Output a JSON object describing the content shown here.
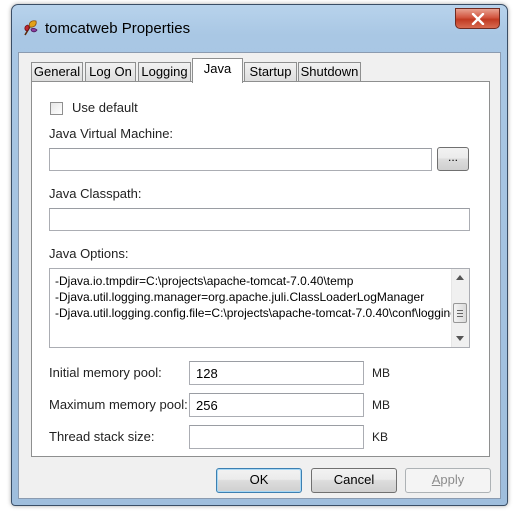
{
  "window": {
    "title": "tomcatweb Properties"
  },
  "tabs": [
    {
      "label": "General"
    },
    {
      "label": "Log On"
    },
    {
      "label": "Logging"
    },
    {
      "label": "Java"
    },
    {
      "label": "Startup"
    },
    {
      "label": "Shutdown"
    }
  ],
  "active_tab": "Java",
  "java": {
    "use_default": {
      "label": "Use default",
      "checked": false
    },
    "jvm": {
      "label": "Java Virtual Machine:",
      "value": "",
      "browse_label": "..."
    },
    "classpath": {
      "label": "Java Classpath:",
      "value": ""
    },
    "options": {
      "label": "Java Options:",
      "lines": [
        "-Djava.io.tmpdir=C:\\projects\\apache-tomcat-7.0.40\\temp",
        "-Djava.util.logging.manager=org.apache.juli.ClassLoaderLogManager",
        "-Djava.util.logging.config.file=C:\\projects\\apache-tomcat-7.0.40\\conf\\logging.properties"
      ]
    },
    "initial_memory": {
      "label": "Initial memory pool:",
      "value": "128",
      "unit": "MB"
    },
    "maximum_memory": {
      "label": "Maximum memory pool:",
      "value": "256",
      "unit": "MB"
    },
    "thread_stack": {
      "label": "Thread stack size:",
      "value": "",
      "unit": "KB"
    }
  },
  "buttons": {
    "ok": "OK",
    "cancel": "Cancel",
    "apply_first": "A",
    "apply_rest": "pply"
  },
  "icons": {
    "app": "tomcat-feather-icon",
    "close": "close-icon"
  },
  "colors": {
    "titlebar": "#a9c7e4",
    "close_button": "#c13a22",
    "panel": "#ffffff",
    "client": "#f0f0f0"
  }
}
